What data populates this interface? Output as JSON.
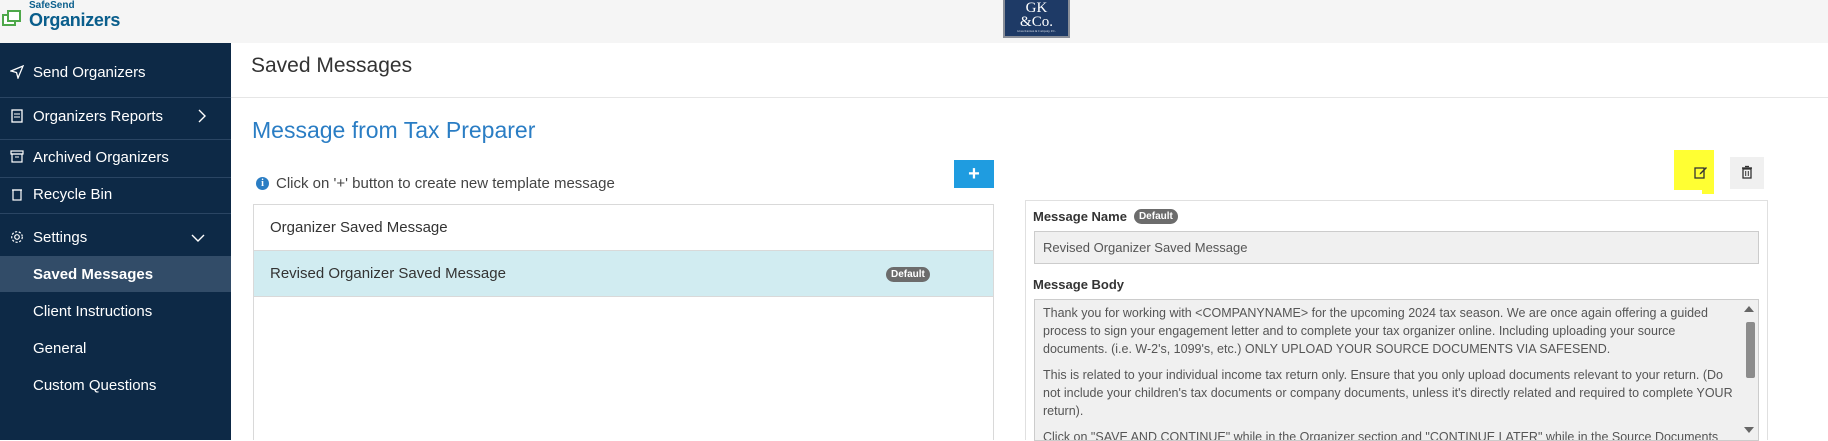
{
  "brand": {
    "small": "SafeSend",
    "big": "Organizers"
  },
  "logo": {
    "line1": "GK",
    "line2": "&Co.",
    "line3": "Glass Kiernan & Company, P.C."
  },
  "sidebar": {
    "items": [
      {
        "label": "Send Organizers",
        "icon": "paper-plane-icon"
      },
      {
        "label": "Organizers Reports",
        "icon": "report-icon"
      },
      {
        "label": "Archived Organizers",
        "icon": "archive-icon"
      },
      {
        "label": "Recycle Bin",
        "icon": "trash-icon"
      },
      {
        "label": "Settings",
        "icon": "gear-icon"
      }
    ],
    "settings_sub": [
      {
        "label": "Saved Messages",
        "active": true
      },
      {
        "label": "Client Instructions"
      },
      {
        "label": "General"
      },
      {
        "label": "Custom Questions"
      }
    ]
  },
  "page": {
    "title": "Saved Messages"
  },
  "section": {
    "title": "Message from Tax Preparer",
    "hint": "Click on '+' button to create new template message",
    "add_label": "+"
  },
  "messages": [
    {
      "name": "Organizer Saved Message",
      "default": false
    },
    {
      "name": "Revised Organizer Saved Message",
      "default": true,
      "badge": "Default"
    }
  ],
  "detail": {
    "name_label": "Message Name",
    "name_badge": "Default",
    "name_value": "Revised Organizer Saved Message",
    "body_label": "Message Body",
    "body_paragraphs": [
      "Thank you for working with <COMPANYNAME> for the upcoming 2024 tax season. We are once again offering a guided process to sign your engagement letter and to complete your tax organizer online. Including uploading your source documents. (i.e. W-2's, 1099's, etc.) ONLY UPLOAD YOUR SOURCE DOCUMENTS VIA SAFESEND.",
      "This is related to your individual income tax return only. Ensure that you only upload documents relevant to your return. (Do not include your children's tax documents or company documents, unless it's directly related and required to complete YOUR return).",
      "Click on \"SAVE AND CONTINUE\" while in the Organizer section and \"CONTINUE LATER\" while in the Source Documents"
    ]
  }
}
